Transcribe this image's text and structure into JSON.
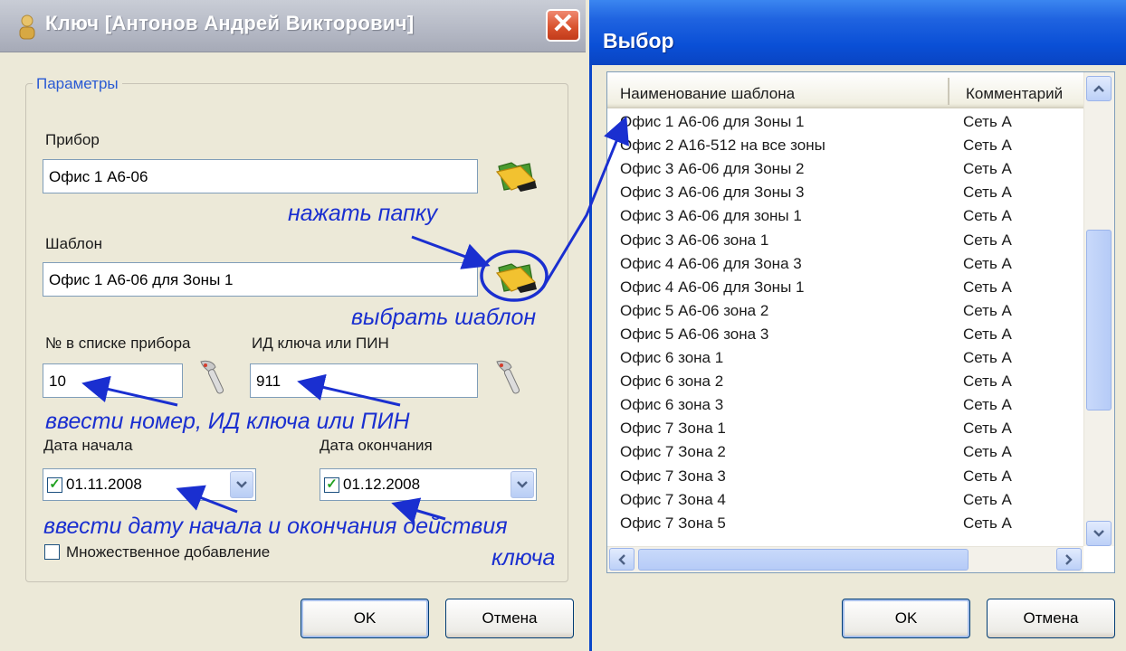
{
  "left_window": {
    "title": "Ключ [Антонов Андрей Викторович]",
    "group_title": "Параметры",
    "device_label": "Прибор",
    "device_value": "Офис 1 А6-06",
    "template_label": "Шаблон",
    "template_value": "Офис 1 А6-06 для Зоны 1",
    "list_no_label": "№ в списке прибора",
    "list_no_value": "10",
    "key_id_label": "ИД ключа или ПИН",
    "key_id_value": "911",
    "start_date_label": "Дата начала",
    "start_date_value": "01.11.2008",
    "end_date_label": "Дата окончания",
    "end_date_value": "01.12.2008",
    "multi_add_label": "Множественное добавление",
    "ok_label": "OK",
    "cancel_label": "Отмена"
  },
  "annotations": {
    "press_folder": "нажать папку",
    "choose_template": "выбрать шаблон",
    "enter_number": "ввести номер, ИД ключа или ПИН",
    "enter_dates_1": "ввести дату начала и окончания действия",
    "enter_dates_2": "ключа"
  },
  "right_window": {
    "title": "Выбор",
    "columns": [
      "Наименование шаблона",
      "Комментарий"
    ],
    "rows": [
      {
        "name": "Офис 1 А6-06 для Зоны 1",
        "comment": "Сеть А"
      },
      {
        "name": "Офис 2 А16-512 на все зоны",
        "comment": "Сеть А"
      },
      {
        "name": "Офис 3 А6-06 для Зоны 2",
        "comment": "Сеть А"
      },
      {
        "name": "Офис 3 А6-06 для Зоны 3",
        "comment": "Сеть А"
      },
      {
        "name": "Офис 3 А6-06 для зоны 1",
        "comment": "Сеть А"
      },
      {
        "name": "Офис 3 А6-06 зона 1",
        "comment": "Сеть А"
      },
      {
        "name": "Офис 4 А6-06 для Зона 3",
        "comment": "Сеть А"
      },
      {
        "name": "Офис 4 А6-06 для Зоны 1",
        "comment": "Сеть А"
      },
      {
        "name": "Офис 5 А6-06 зона 2",
        "comment": "Сеть А"
      },
      {
        "name": "Офис 5 А6-06 зона 3",
        "comment": "Сеть А"
      },
      {
        "name": "Офис 6 зона 1",
        "comment": "Сеть А"
      },
      {
        "name": "Офис 6 зона 2",
        "comment": "Сеть А"
      },
      {
        "name": "Офис 6 зона 3",
        "comment": "Сеть А"
      },
      {
        "name": "Офис 7 Зона 1",
        "comment": "Сеть А"
      },
      {
        "name": "Офис 7 Зона 2",
        "comment": "Сеть А"
      },
      {
        "name": "Офис 7 Зона 3",
        "comment": "Сеть А"
      },
      {
        "name": "Офис 7 Зона 4",
        "comment": "Сеть А"
      },
      {
        "name": "Офис 7 Зона 5",
        "comment": "Сеть А"
      }
    ],
    "ok_label": "OK",
    "cancel_label": "Отмена"
  },
  "icons": {
    "folder": "folder-open-icon",
    "reader": "key-reader-icon",
    "close": "close-icon",
    "dropdown": "chevron-down-icon",
    "scroll_up": "chevron-up-icon",
    "scroll_down": "chevron-down-icon",
    "scroll_left": "chevron-left-icon",
    "scroll_right": "chevron-right-icon"
  },
  "colors": {
    "annotation": "#1a2fd0",
    "title_blue": "#0a4fd6",
    "checkbox_check": "#21a121"
  }
}
